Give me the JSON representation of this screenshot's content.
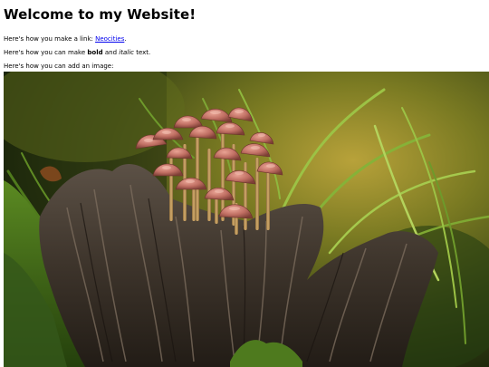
{
  "heading": "Welcome to my Website!",
  "link_line": {
    "prefix": "Here's how you make a link: ",
    "link_text": "Neocities",
    "suffix": "."
  },
  "format_line": {
    "prefix": "Here's how you can make ",
    "bold": "bold",
    "middle": " and ",
    "italic": "italic",
    "suffix": " text."
  },
  "image_line": "Here's how you can add an image:",
  "colors": {
    "link": "#0000ee",
    "text": "#000000",
    "background": "#ffffff"
  }
}
